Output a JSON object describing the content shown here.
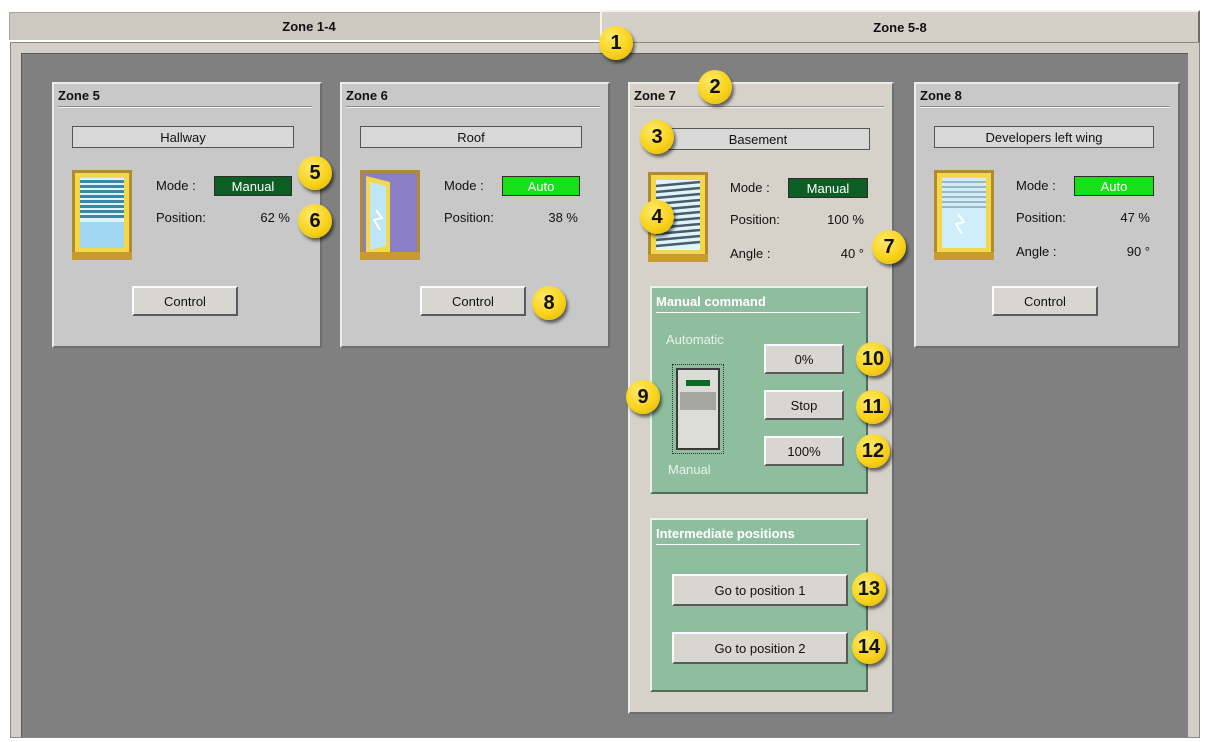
{
  "tabs": [
    {
      "label": "Zone 1-4"
    },
    {
      "label": "Zone 5-8"
    }
  ],
  "zones": {
    "z5": {
      "title": "Zone 5",
      "location": "Hallway",
      "mode_label": "Mode :",
      "mode": "Manual",
      "position_label": "Position:",
      "position": "62 %",
      "control_label": "Control"
    },
    "z6": {
      "title": "Zone 6",
      "location": "Roof",
      "mode_label": "Mode :",
      "mode": "Auto",
      "position_label": "Position:",
      "position": "38 %",
      "control_label": "Control"
    },
    "z7": {
      "title": "Zone 7",
      "location": "Basement",
      "mode_label": "Mode :",
      "mode": "Manual",
      "position_label": "Position:",
      "position": "100 %",
      "angle_label": "Angle :",
      "angle": "40 °",
      "manual_command": {
        "title": "Manual command",
        "automatic_label": "Automatic",
        "manual_label": "Manual",
        "btn_0": "0%",
        "btn_stop": "Stop",
        "btn_100": "100%"
      },
      "intermediate": {
        "title": "Intermediate positions",
        "pos1": "Go to position 1",
        "pos2": "Go to position 2"
      }
    },
    "z8": {
      "title": "Zone 8",
      "location": "Developers left wing",
      "mode_label": "Mode :",
      "mode": "Auto",
      "position_label": "Position:",
      "position": "47 %",
      "angle_label": "Angle :",
      "angle": "90 °",
      "control_label": "Control"
    }
  },
  "callouts": [
    "1",
    "2",
    "3",
    "4",
    "5",
    "6",
    "7",
    "8",
    "9",
    "10",
    "11",
    "12",
    "13",
    "14"
  ],
  "colors": {
    "manual_mode": "#0c5e24",
    "auto_mode": "#18e018",
    "panel_green": "#8fbe9f",
    "callout_yellow": "#f8d31c"
  }
}
